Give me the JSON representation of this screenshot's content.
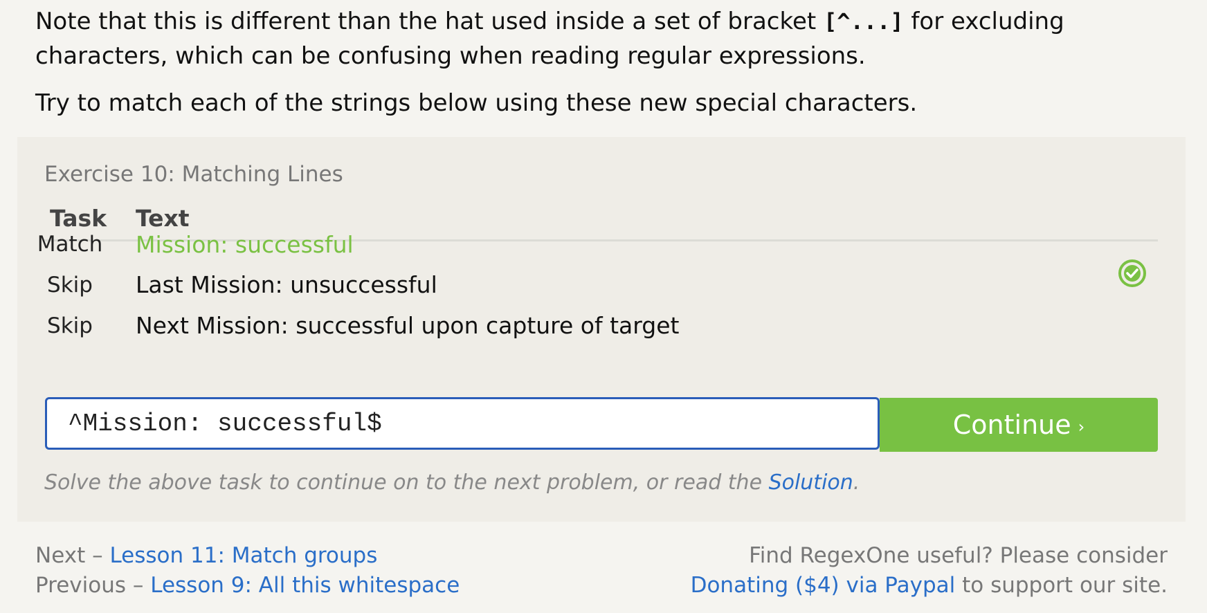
{
  "intro": {
    "p1_before": "Note that this is different than the hat used inside a set of bracket ",
    "p1_code": "[^...]",
    "p1_after": " for excluding characters, which can be confusing when reading regular expressions.",
    "p2": "Try to match each of the strings below using these new special characters."
  },
  "exercise": {
    "title": "Exercise 10: Matching Lines",
    "headers": {
      "task": "Task",
      "text": "Text"
    },
    "rows": [
      {
        "task": "Match",
        "text": "Mission: successful",
        "status": "matched"
      },
      {
        "task": "Skip",
        "text": "Last Mission: unsuccessful"
      },
      {
        "task": "Skip",
        "text": "Next Mission: successful upon capture of target"
      }
    ],
    "input_value": "^Mission: successful$",
    "continue_label": "Continue",
    "continue_chevron": "›",
    "hint_before": "Solve the above task to continue on to the next problem, or read the ",
    "hint_link": "Solution",
    "hint_after": "."
  },
  "footer": {
    "next_prefix": "Next – ",
    "next_link": "Lesson 11: Match groups",
    "prev_prefix": "Previous – ",
    "prev_link": "Lesson 9: All this whitespace",
    "support_line": "Find RegexOne useful? Please consider",
    "donate_link": "Donating ($4) via Paypal",
    "donate_suffix": " to support our site."
  },
  "colors": {
    "accent_green": "#78c143",
    "link_blue": "#2a6ec8",
    "input_border": "#2a5db8"
  },
  "icons": {
    "matched": "check-circle-icon"
  }
}
